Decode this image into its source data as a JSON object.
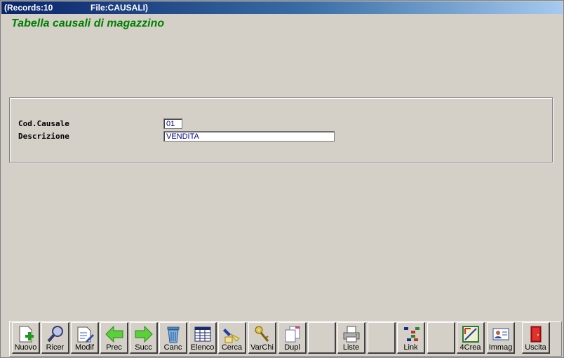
{
  "window": {
    "records": "(Records:10",
    "file": "File:CAUSALI)"
  },
  "header": {
    "title": "Tabella causali di magazzino"
  },
  "form": {
    "cod_label": "Cod.Causale",
    "cod_value": "01",
    "desc_label": "Descrizione",
    "desc_value": "VENDITA"
  },
  "toolbar": {
    "nuovo": "Nuovo",
    "ricer": "Ricer",
    "modif": "Modif",
    "prec": "Prec",
    "succ": "Succ",
    "canc": "Canc",
    "elenco": "Elenco",
    "cerca": "Cerca",
    "varchi": "VarChi",
    "dupl": "Dupl",
    "liste": "Liste",
    "link": "Link",
    "crea4": "4Crea",
    "immag": "Immag",
    "uscita": "Uscita"
  }
}
